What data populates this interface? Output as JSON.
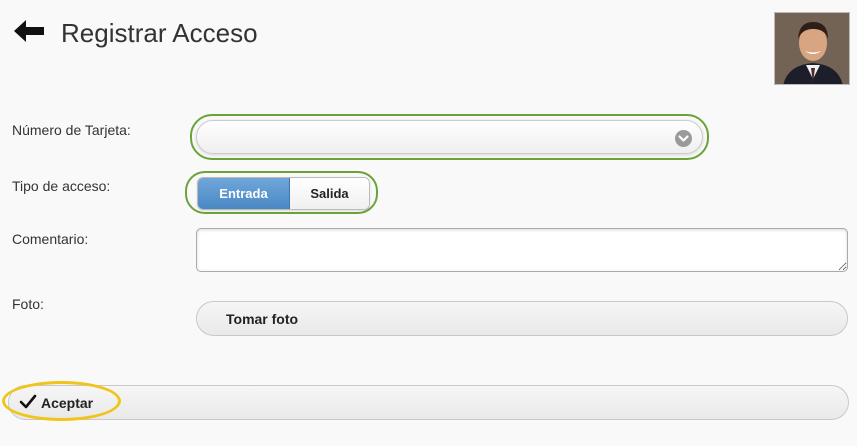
{
  "header": {
    "back_icon": "arrow-left-icon",
    "title": "Registrar Acceso",
    "avatar": "user-photo"
  },
  "form": {
    "card_number": {
      "label": "Número de Tarjeta:",
      "value": "",
      "icon": "chevron-down-icon",
      "highlight_color": "#6aa339"
    },
    "access_type": {
      "label": "Tipo de acceso:",
      "options": [
        "Entrada",
        "Salida"
      ],
      "selected": "Entrada",
      "selected_color": "#4a88c4"
    },
    "comment": {
      "label": "Comentario:",
      "value": ""
    },
    "photo": {
      "label": "Foto:",
      "button_label": "Tomar foto"
    }
  },
  "footer": {
    "accept_label": "Aceptar",
    "accept_icon": "check-icon",
    "highlight_color": "#f0c419"
  }
}
